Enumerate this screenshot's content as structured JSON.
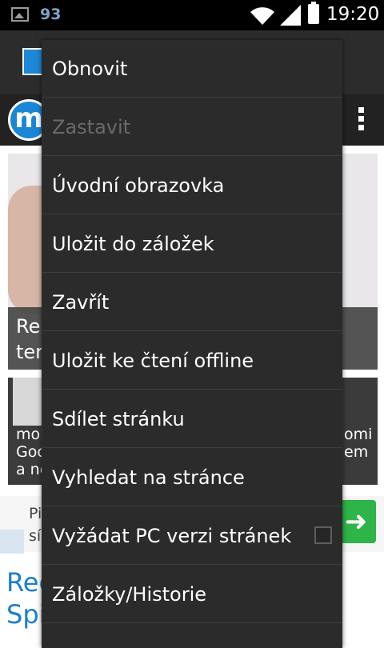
{
  "status_bar": {
    "notification_count": "93",
    "time": "19:20"
  },
  "background": {
    "tile1_caption": [
      "Re",
      "ter"
    ],
    "tile2_caption_left": [
      "mol",
      "Goc",
      "a ně"
    ],
    "tile2_caption_right": [
      "omi",
      "em"
    ],
    "ad_text": [
      "Pi",
      "sí"
    ],
    "ad_button_icon": "arrow-right-icon",
    "article_title": [
      "Rec",
      "Spi"
    ]
  },
  "menu": {
    "items": [
      {
        "label": "Obnovit",
        "enabled": true
      },
      {
        "label": "Zastavit",
        "enabled": false
      },
      {
        "label": "Úvodní obrazovka",
        "enabled": true
      },
      {
        "label": "Uložit do záložek",
        "enabled": true
      },
      {
        "label": "Zavřít",
        "enabled": true
      },
      {
        "label": "Uložit ke čtení offline",
        "enabled": true
      },
      {
        "label": "Sdílet stránku",
        "enabled": true
      },
      {
        "label": "Vyhledat na stránce",
        "enabled": true
      },
      {
        "label": "Vyžádat PC verzi stránek",
        "enabled": true,
        "checkbox": false
      },
      {
        "label": "Záložky/Historie",
        "enabled": true
      }
    ]
  }
}
